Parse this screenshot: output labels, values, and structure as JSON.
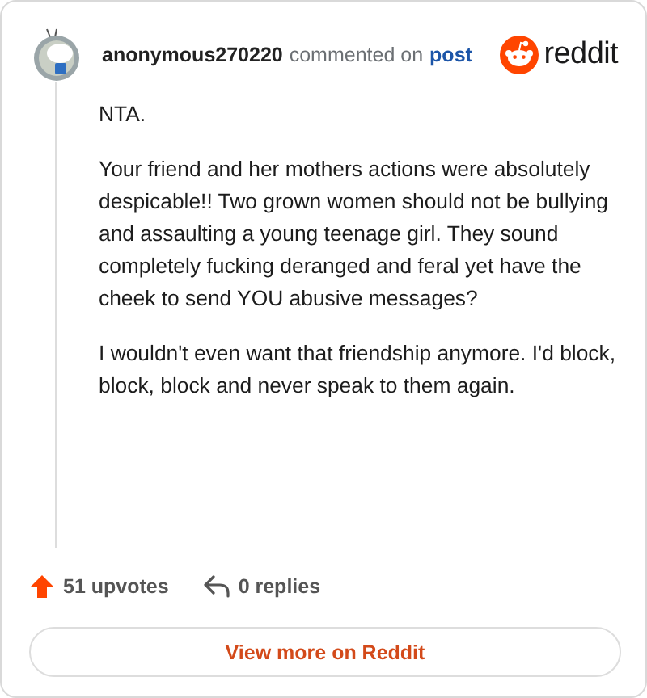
{
  "header": {
    "username": "anonymous270220",
    "action": "commented on",
    "link": "post",
    "brand": "reddit"
  },
  "paragraphs": [
    "NTA.",
    "Your friend and her mothers actions were absolutely despicable!! Two grown women should not be bullying and assaulting a young teenage girl. They sound completely fucking deranged and feral yet have the cheek to send YOU abusive messages?",
    "I wouldn't even want that friendship anymore. I'd block, block, block and never speak to them again."
  ],
  "footer": {
    "upvotes": "51 upvotes",
    "replies": "0 replies"
  },
  "button": "View more on Reddit"
}
